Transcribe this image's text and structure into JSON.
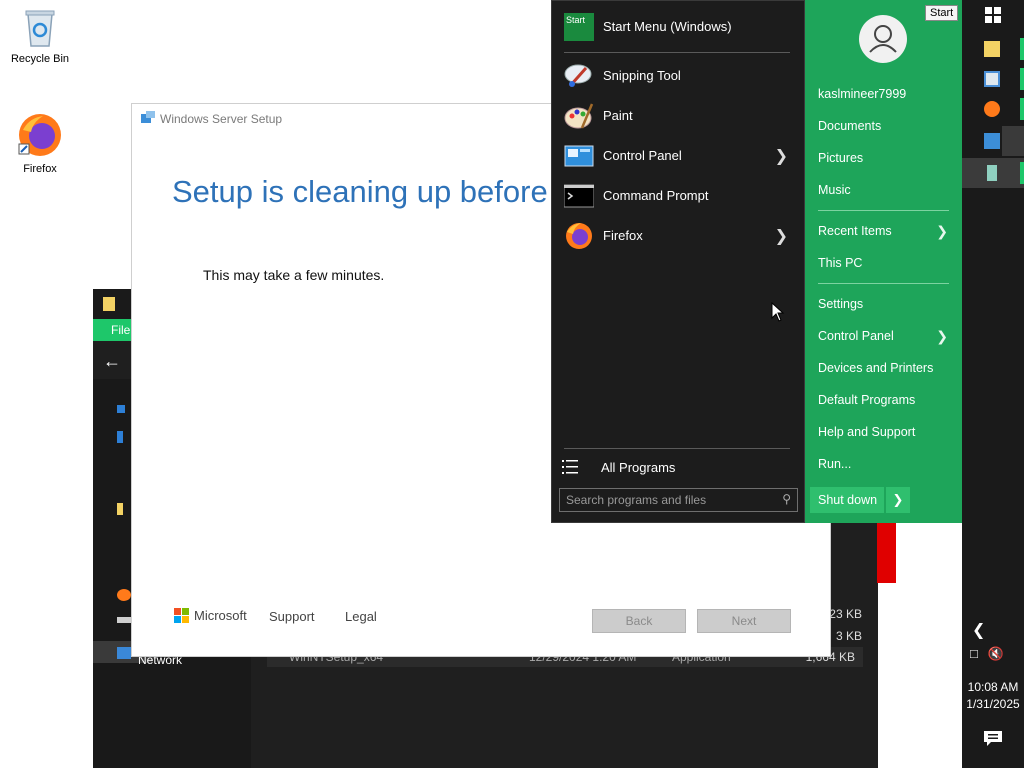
{
  "desktop": {
    "icons": [
      {
        "label": "Recycle Bin",
        "icon": "recycle-bin-icon"
      },
      {
        "label": "Firefox",
        "icon": "firefox-icon"
      }
    ]
  },
  "explorer": {
    "ribbon_tab": "File",
    "network_label": "Network",
    "file": {
      "name": "WinNTSetup_x64",
      "date": "12/29/2024 1:20 AM",
      "type": "Application",
      "size": "1,664 KB"
    },
    "sizes": [
      "23 KB",
      "3 KB"
    ]
  },
  "setup": {
    "title": "Windows Server Setup",
    "heading": "Setup is cleaning up before i",
    "message": "This may take a few minutes.",
    "brand": "Microsoft",
    "links": {
      "support": "Support",
      "legal": "Legal"
    },
    "buttons": {
      "back": "Back",
      "next": "Next"
    }
  },
  "start_menu": {
    "pinned": [
      {
        "label": "Start Menu (Windows)",
        "icon": "start-menu-icon",
        "arrow": false
      },
      {
        "label": "Snipping Tool",
        "icon": "snipping-tool-icon",
        "arrow": false
      },
      {
        "label": "Paint",
        "icon": "paint-icon",
        "arrow": false
      },
      {
        "label": "Control Panel",
        "icon": "control-panel-icon",
        "arrow": true
      },
      {
        "label": "Command Prompt",
        "icon": "command-prompt-icon",
        "arrow": false
      },
      {
        "label": "Firefox",
        "icon": "firefox-icon",
        "arrow": true
      }
    ],
    "all_programs": "All Programs",
    "search_placeholder": "Search programs and files",
    "start_tile_text": "Start",
    "user": "kaslmineer7999",
    "right_items": {
      "documents": "Documents",
      "pictures": "Pictures",
      "music": "Music",
      "recent_items": "Recent Items",
      "this_pc": "This PC",
      "settings": "Settings",
      "control_panel": "Control Panel",
      "devices_printers": "Devices and Printers",
      "default_programs": "Default Programs",
      "help_support": "Help and Support",
      "run": "Run..."
    },
    "shutdown": "Shut down"
  },
  "tooltip": "Start",
  "taskbar": {
    "time": "10:08 AM",
    "date": "1/31/2025"
  },
  "colors": {
    "accent_green": "#1ea55a",
    "heading_blue": "#2e72b8",
    "start_left_bg": "#1c1c1c"
  }
}
